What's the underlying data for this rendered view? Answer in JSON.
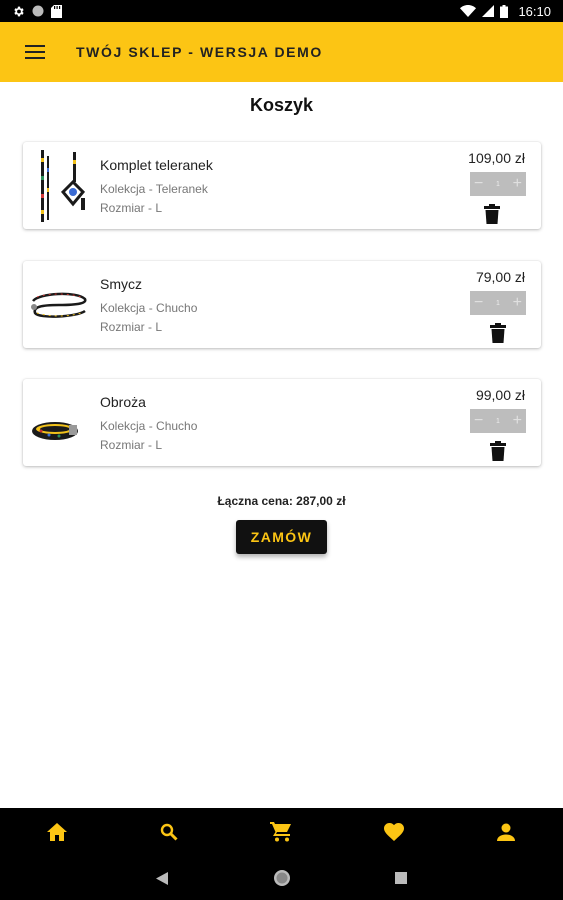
{
  "status_bar": {
    "time": "16:10",
    "icons": [
      "settings-icon",
      "circle-icon",
      "sd-card-icon",
      "wifi-icon",
      "signal-icon",
      "battery-icon"
    ]
  },
  "app_bar": {
    "title": "TWÓJ SKLEP - WERSJA DEMO",
    "background": "#fcc514"
  },
  "page": {
    "title": "Koszyk"
  },
  "cart": {
    "items": [
      {
        "name": "Komplet teleranek",
        "collection": "Kolekcja - Teleranek",
        "size": "Rozmiar - L",
        "price": "109,00 zł",
        "quantity": "1",
        "thumb": "leash-harness-set"
      },
      {
        "name": "Smycz",
        "collection": "Kolekcja - Chucho",
        "size": "Rozmiar - L",
        "price": "79,00 zł",
        "quantity": "1",
        "thumb": "leash"
      },
      {
        "name": "Obroża",
        "collection": "Kolekcja - Chucho",
        "size": "Rozmiar - L",
        "price": "99,00 zł",
        "quantity": "1",
        "thumb": "collar"
      }
    ],
    "stepper_minus": "−",
    "stepper_plus": "+",
    "total_label": "Łączna cena: 287,00 zł",
    "order_label": "ZAMÓW"
  },
  "bottom_nav": {
    "items": [
      "home-icon",
      "search-icon",
      "cart-icon",
      "heart-icon",
      "person-icon"
    ],
    "accent": "#fcc514"
  },
  "system_nav": [
    "back-icon",
    "home-circle-icon",
    "recents-icon"
  ]
}
